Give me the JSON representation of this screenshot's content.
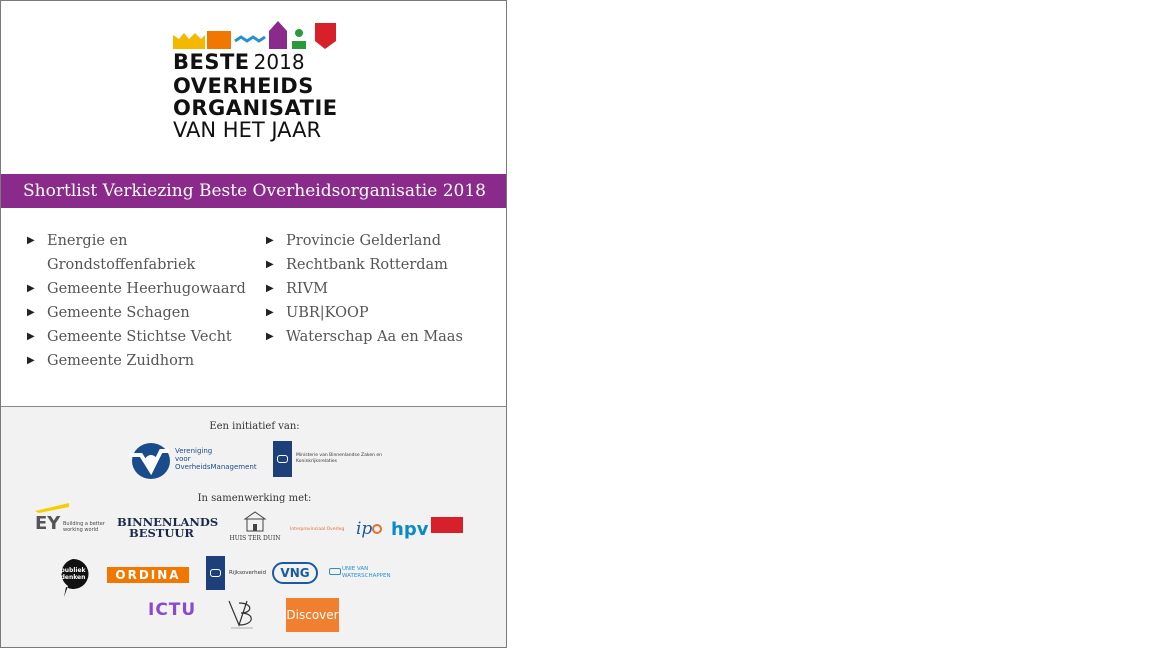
{
  "logo": {
    "line1": "BESTE",
    "year": "2018",
    "line2": "OVERHEIDS",
    "line3": "ORGANISATIE",
    "line4": "VAN HET JAAR"
  },
  "banner": "Shortlist Verkiezing Beste Overheidsorganisatie 2018",
  "shortlist": {
    "column1": [
      "Energie en Grondstoffenfabriek",
      "Gemeente Heerhugowaard",
      "Gemeente Schagen",
      "Gemeente Stichtse Vecht",
      "Gemeente Zuidhorn"
    ],
    "column2": [
      "Provincie Gelderland",
      "Rechtbank Rotterdam",
      "RIVM",
      "UBR|KOOP",
      "Waterschap Aa en Maas"
    ]
  },
  "sponsors": {
    "initiative_caption": "Een initiatief van:",
    "cooperation_caption": "In samenwerking met:",
    "vom_line1": "Vereniging",
    "vom_line2": "voor",
    "vom_line3": "OverheidsManagement",
    "minbzk_line1": "Ministerie van Binnenlandse Zaken en",
    "minbzk_line2": "Koninkrijksrelaties",
    "ey": "EY",
    "ey_tag1": "Building a better",
    "ey_tag2": "working world",
    "binnenlands1": "BINNENLANDS",
    "binnenlands2": "BESTUUR",
    "huis": "HUIS TER DUIN",
    "ipo_small": "Interprovinciaal Overleg",
    "ipo": "ip",
    "hpv": "hpv",
    "publiek1": "publiek",
    "publiek2": "denken",
    "ordina": "ORDINA",
    "rijksoverheid": "Rijksoverheid",
    "vng": "VNG",
    "unie1": "UNIE VAN",
    "unie2": "WATERSCHAPPEN",
    "ictu": "ICTU",
    "discover": "Discover"
  },
  "colors": {
    "banner": "#8a2a8a",
    "logo_yellow": "#f5b800",
    "logo_orange": "#f07800",
    "logo_blue": "#2a8fd0",
    "logo_purple": "#8a2a8a",
    "logo_green": "#2a9a3a",
    "logo_red": "#d8202a"
  }
}
